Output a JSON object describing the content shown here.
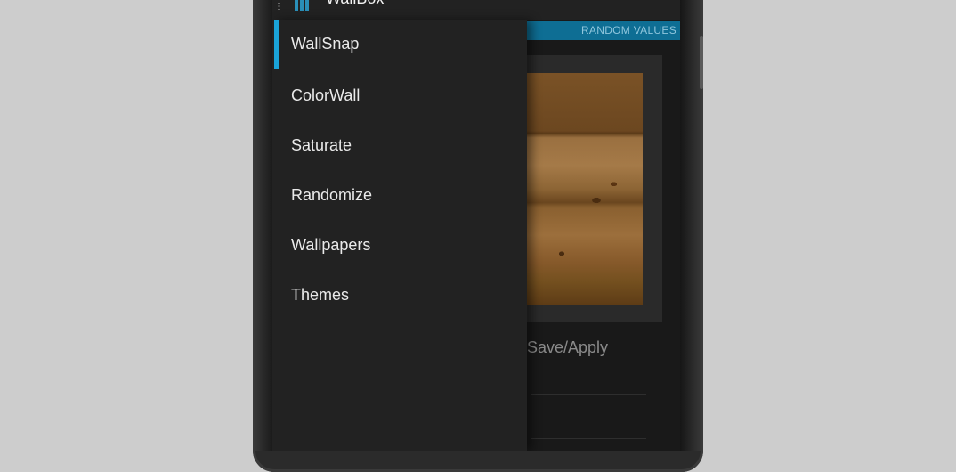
{
  "app": {
    "title": "WallBox",
    "icon": "bar-chart-icon"
  },
  "content": {
    "random_values_label": "RANDOM VALUES",
    "save_apply_label": "Save/Apply"
  },
  "drawer": {
    "items": [
      {
        "label": "WallSnap",
        "active": true
      },
      {
        "label": "ColorWall",
        "active": false
      },
      {
        "label": "Saturate",
        "active": false
      },
      {
        "label": "Randomize",
        "active": false
      },
      {
        "label": "Wallpapers",
        "active": false
      },
      {
        "label": "Themes",
        "active": false
      }
    ]
  },
  "colors": {
    "accent": "#1aa3d8",
    "random_bar": "#0e6e94"
  }
}
